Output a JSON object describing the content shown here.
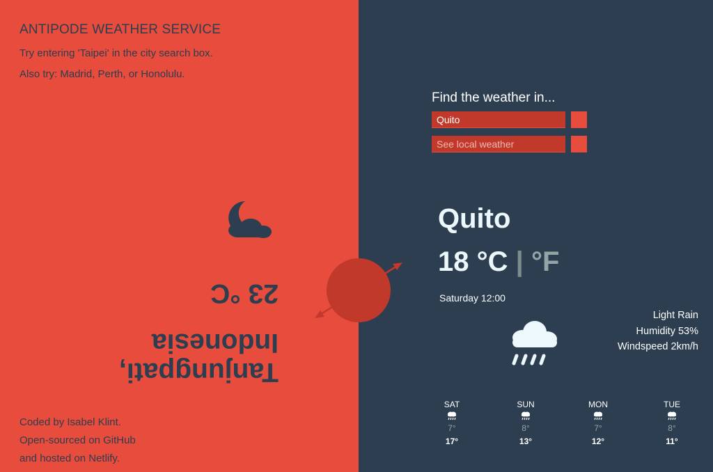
{
  "intro": {
    "title": "ANTIPODE WEATHER SERVICE",
    "hint": "Try entering 'Taipei' in the city search box.",
    "also": "Also try: Madrid, Perth, or Honolulu."
  },
  "credits": {
    "line1": "Coded by Isabel Klint.",
    "line2": "Open-sourced on GitHub",
    "line3": "and hosted on Netlify."
  },
  "antipode": {
    "city_line1": "Tanjungpati,",
    "city_line2": "Indonesia",
    "temperature": "23 °C",
    "icon": "night-cloudy-icon"
  },
  "search": {
    "label": "Find the weather in...",
    "city_value": "Quito",
    "local_label": "See local weather"
  },
  "current": {
    "city": "Quito",
    "temp_c": "18 °C",
    "separator": "|",
    "unit_f": "°F",
    "datetime": "Saturday 12:00",
    "description": "Light Rain",
    "humidity": "Humidity 53%",
    "wind": "Windspeed 2km/h",
    "icon": "rain-cloud-icon"
  },
  "forecast": [
    {
      "day": "SAT",
      "low": "7°",
      "high": "17°",
      "icon": "rain-icon"
    },
    {
      "day": "SUN",
      "low": "8°",
      "high": "13°",
      "icon": "rain-icon"
    },
    {
      "day": "MON",
      "low": "7°",
      "high": "12°",
      "icon": "rain-icon"
    },
    {
      "day": "TUE",
      "low": "8°",
      "high": "11°",
      "icon": "rain-icon"
    }
  ],
  "colors": {
    "left_bg": "#e74c3c",
    "right_bg": "#2c3e50",
    "accent": "#c0392b",
    "text_dark": "#2c3e50"
  }
}
